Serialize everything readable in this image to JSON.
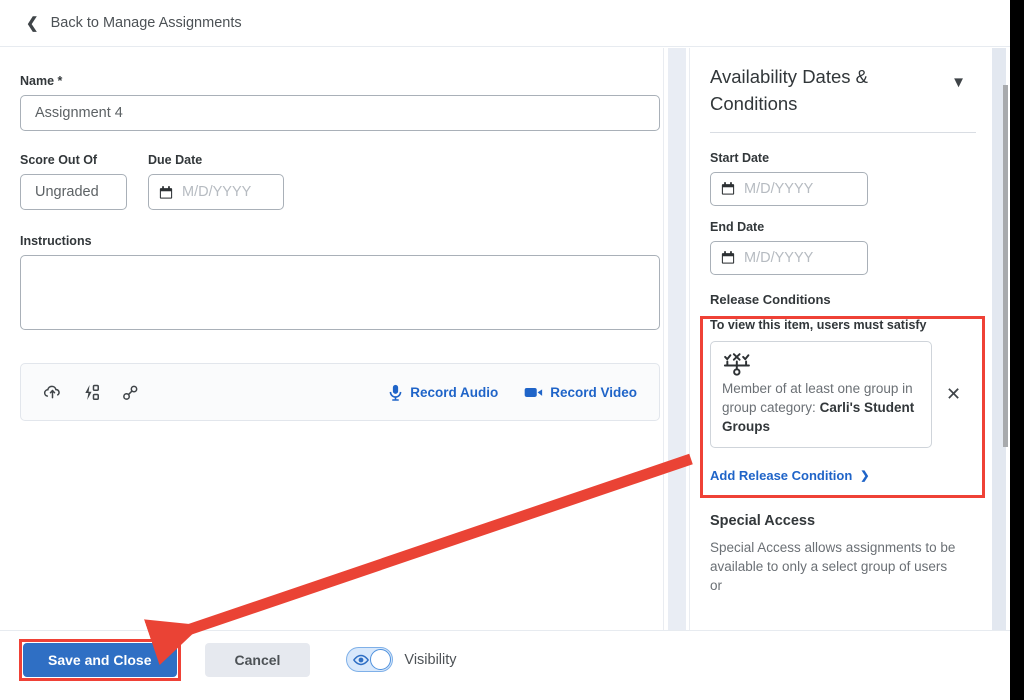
{
  "header": {
    "back_label": "Back to Manage Assignments",
    "back_icon": "chevron-left-icon"
  },
  "top_dropdown": {
    "caret_icon": "chevron-down-icon"
  },
  "form": {
    "name_label": "Name *",
    "name_value": "Assignment 4",
    "score_label": "Score Out Of",
    "score_value": "Ungraded",
    "due_date_label": "Due Date",
    "due_date_placeholder": "M/D/YYYY",
    "instructions_label": "Instructions",
    "instructions_value": ""
  },
  "editor_toolbar": {
    "icons": [
      {
        "name": "upload-icon",
        "title": "Insert Stuff"
      },
      {
        "name": "quicklink-icon",
        "title": "Quicklink"
      },
      {
        "name": "link-icon",
        "title": "Insert Link"
      }
    ],
    "record_audio": "Record Audio",
    "record_video": "Record Video",
    "record_audio_icon": "microphone-icon",
    "record_video_icon": "video-camera-icon"
  },
  "panel": {
    "title": "Availability Dates & Conditions",
    "collapse_icon": "caret-down-icon",
    "start_date_label": "Start Date",
    "start_date_placeholder": "M/D/YYYY",
    "end_date_label": "End Date",
    "end_date_placeholder": "M/D/YYYY",
    "date_icon": "calendar-icon"
  },
  "release_conditions": {
    "title": "Release Conditions",
    "subtitle": "To view this item, users must satisfy",
    "condition_icon": "release-condition-icon",
    "condition_text": "Member of at least one group in group category:",
    "condition_value": "Carli's Student Groups",
    "remove_icon": "close-x-icon",
    "add_label": "Add Release Condition",
    "add_caret_icon": "chevron-down-icon",
    "highlight_color": "#ef4136"
  },
  "special_access": {
    "title": "Special Access",
    "description": "Special Access allows assignments to be available to only a select group of users or"
  },
  "bottom_bar": {
    "save_label": "Save and Close",
    "cancel_label": "Cancel",
    "visibility_label": "Visibility",
    "visibility_on": true,
    "visibility_icon": "eye-icon",
    "save_accent": "#2f6fc4",
    "highlight_color": "#ef4136"
  },
  "annotations": {
    "arrow_color": "#ea4335",
    "arrow_target": "save-and-close-button"
  },
  "scrollbar": {
    "name": "vertical-scrollbar"
  }
}
